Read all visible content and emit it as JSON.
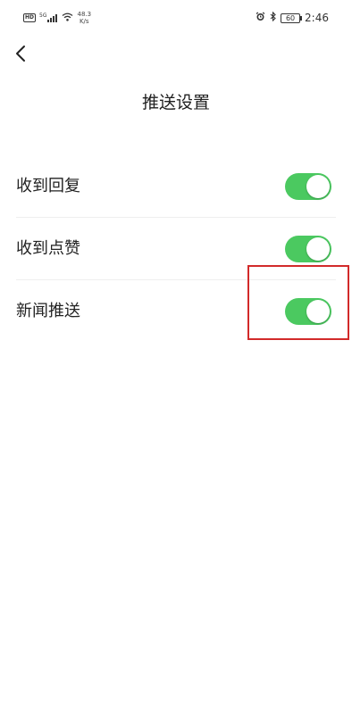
{
  "status_bar": {
    "hd_label": "HD",
    "network_type": "5G",
    "net_speed_value": "48.3",
    "net_speed_unit": "K/s",
    "battery_level": "60",
    "time": "2:46",
    "icons": [
      "alarm-icon",
      "bluetooth-icon"
    ]
  },
  "header": {
    "back_icon": "chevron-left-icon",
    "title": "推送设置"
  },
  "settings": [
    {
      "label": "收到回复",
      "enabled": true
    },
    {
      "label": "收到点赞",
      "enabled": true
    },
    {
      "label": "新闻推送",
      "enabled": true
    }
  ],
  "colors": {
    "toggle_on": "#4bc960",
    "highlight": "#d22a2a"
  }
}
